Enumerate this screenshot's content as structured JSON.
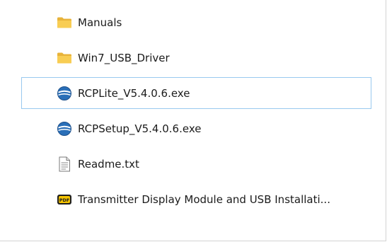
{
  "files": [
    {
      "name": "Manuals",
      "icon": "folder-icon",
      "selected": false
    },
    {
      "name": "Win7_USB_Driver",
      "icon": "folder-icon",
      "selected": false
    },
    {
      "name": "RCPLite_V5.4.0.6.exe",
      "icon": "executable-icon",
      "selected": true
    },
    {
      "name": "RCPSetup_V5.4.0.6.exe",
      "icon": "executable-icon",
      "selected": false
    },
    {
      "name": "Readme.txt",
      "icon": "text-file-icon",
      "selected": false
    },
    {
      "name": "Transmitter Display Module and USB Installati...",
      "icon": "pdf-file-icon",
      "selected": false
    }
  ],
  "colors": {
    "selection_border": "#99c9ef",
    "folder": "#f4c542",
    "exe_blue": "#2a6fb8"
  }
}
